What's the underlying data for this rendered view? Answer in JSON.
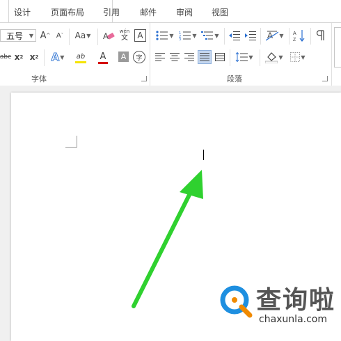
{
  "tabs": {
    "design": "设计",
    "layout": "页面布局",
    "references": "引用",
    "mailings": "邮件",
    "review": "审阅",
    "view": "视图"
  },
  "font_group": {
    "label": "字体",
    "font_size_value": "五号",
    "grow_font": "A",
    "shrink_font": "A",
    "change_case": "Aa",
    "phonetic_top": "wén",
    "phonetic_bottom": "文",
    "char_border": "A",
    "strikethrough": "abc",
    "subscript": "x",
    "subscript_mark": "2",
    "superscript": "x",
    "superscript_mark": "2",
    "text_effects": "A",
    "highlight": "ab",
    "font_color": "A",
    "char_shading": "A",
    "enclose_char": "字"
  },
  "paragraph_group": {
    "label": "段落"
  },
  "colors": {
    "highlight_yellow": "#f5e400",
    "font_color_red": "#d40000",
    "arrow_green": "#2fd12f",
    "logo_blue": "#1e8fe0",
    "logo_orange": "#f08a00"
  },
  "watermark": {
    "title": "查询啦",
    "url": "chaxunla.com"
  }
}
